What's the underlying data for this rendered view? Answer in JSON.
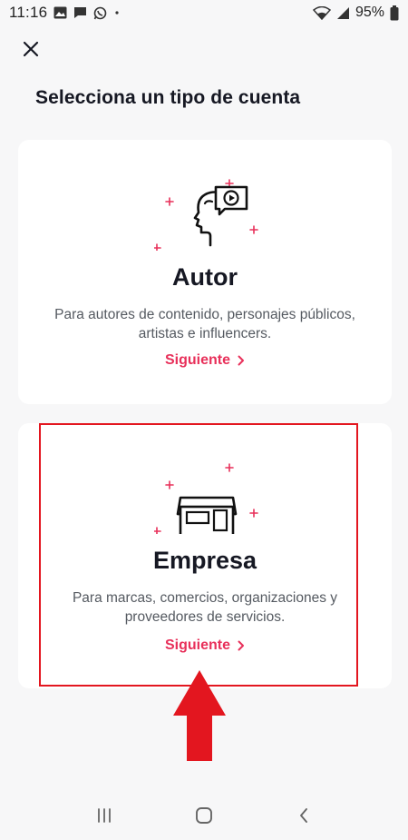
{
  "status_bar": {
    "time": "11:16",
    "battery": "95%",
    "icons": [
      "image-icon",
      "message-icon",
      "whatsapp-icon",
      "dot-icon",
      "wifi-icon",
      "signal-icon",
      "battery-icon"
    ]
  },
  "page": {
    "title": "Selecciona un tipo de cuenta"
  },
  "cards": [
    {
      "title": "Autor",
      "description": "Para autores de contenido, personajes públicos, artistas e influencers.",
      "link": "Siguiente",
      "icon": "creator-head-icon"
    },
    {
      "title": "Empresa",
      "description": "Para marcas, comercios, organizaciones y proveedores de servicios.",
      "link": "Siguiente",
      "icon": "storefront-icon"
    }
  ],
  "colors": {
    "accent": "#e8305a",
    "annotation": "#e3161f",
    "background": "#f7f7f8",
    "card": "#ffffff"
  },
  "nav_bar": {
    "icons": [
      "recents-icon",
      "home-icon",
      "back-icon"
    ]
  }
}
